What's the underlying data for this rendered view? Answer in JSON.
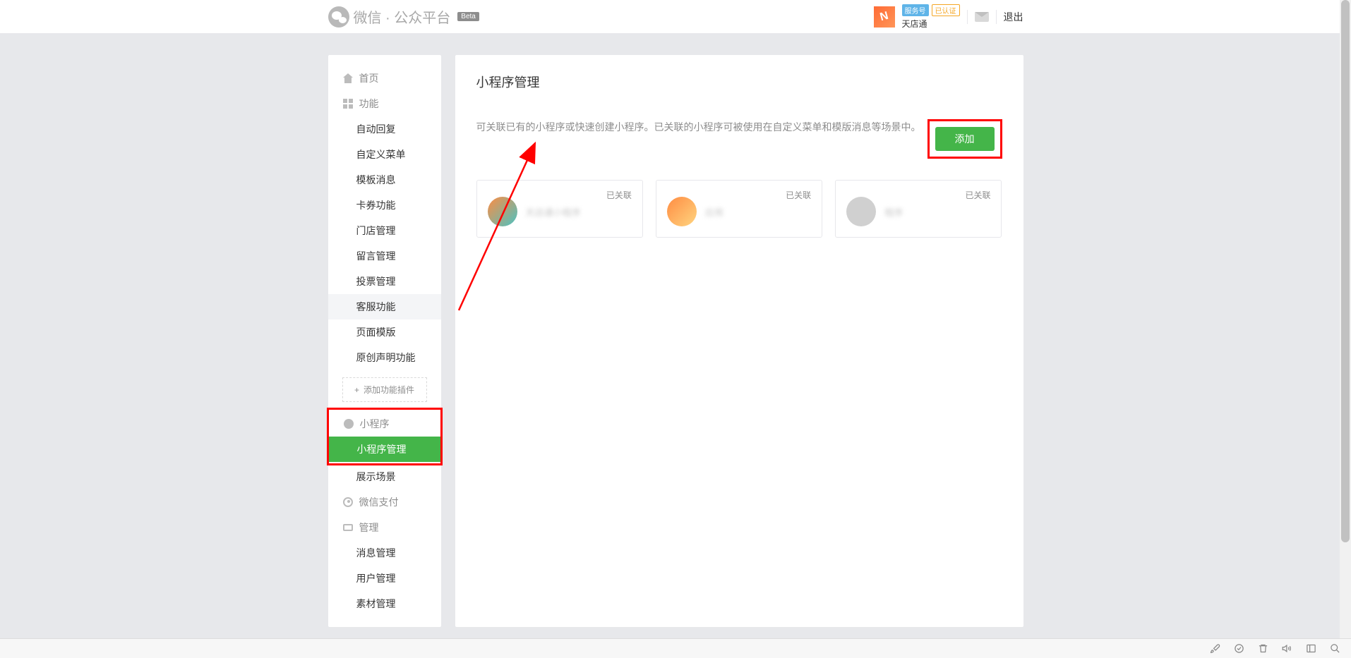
{
  "header": {
    "platform_name": "微信 · 公众平台",
    "beta_label": "Beta",
    "account_name": "天店通",
    "tag_service": "服务号",
    "tag_verified": "已认证",
    "logout": "退出",
    "avatar_text": "N"
  },
  "sidebar": {
    "home": "首页",
    "functions_label": "功能",
    "function_items": [
      "自动回复",
      "自定义菜单",
      "模板消息",
      "卡券功能",
      "门店管理",
      "留言管理",
      "投票管理",
      "客服功能",
      "页面模版",
      "原创声明功能"
    ],
    "add_plugin": "添加功能插件",
    "miniapp_label": "小程序",
    "miniapp_items": [
      "小程序管理",
      "展示场景"
    ],
    "wechat_pay": "微信支付",
    "management_label": "管理",
    "management_items": [
      "消息管理",
      "用户管理",
      "素材管理"
    ]
  },
  "content": {
    "title": "小程序管理",
    "description": "可关联已有的小程序或快速创建小程序。已关联的小程序可被使用在自定义菜单和模版消息等场景中。",
    "add_button": "添加",
    "status_linked": "已关联",
    "apps": [
      {
        "name_blur": "天店通小程序"
      },
      {
        "name_blur": "应用"
      },
      {
        "name_blur": "程序"
      }
    ]
  }
}
